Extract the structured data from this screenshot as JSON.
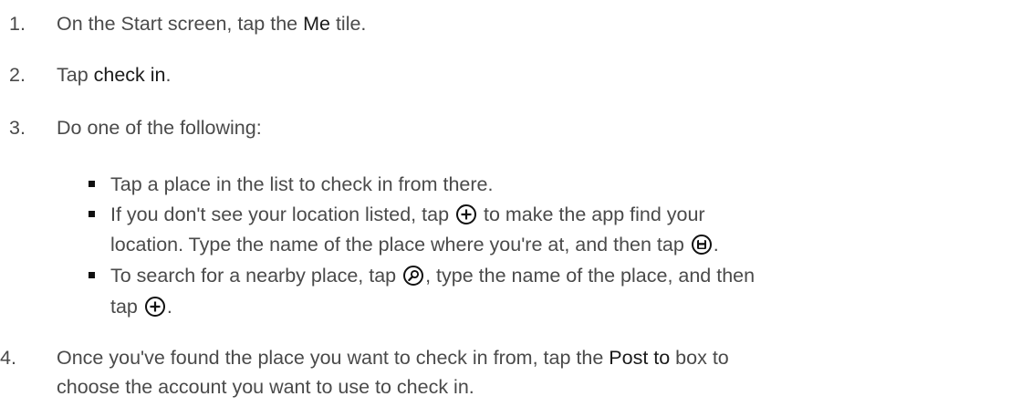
{
  "steps": [
    {
      "number": "1.",
      "pre": "On the Start screen, tap the ",
      "term": "Me",
      "post": " tile."
    },
    {
      "number": "2.",
      "pre": "Tap ",
      "term": "check in",
      "post": "."
    },
    {
      "number": "3.",
      "text": "Do one of the following:"
    },
    {
      "number": "4.",
      "line1_pre": "Once you've found the place you want to check in from, tap the ",
      "line1_term": "Post to",
      "line1_post": " box to",
      "line2": "choose the account you want to use to check in."
    }
  ],
  "bullets": [
    {
      "text": "Tap a place in the list to check in from there."
    },
    {
      "line1_pre": "If you don't see your location listed, tap ",
      "line1_icon": "plus-circle-icon",
      "line1_post": " to make the app find your",
      "line2_pre": "location. Type the name of the place where you're at, and then tap ",
      "line2_icon": "save-circle-icon",
      "line2_post": "."
    },
    {
      "line1_pre": "To search for a nearby place, tap ",
      "line1_icon": "search-circle-icon",
      "line1_post": ", type the name of the place, and then",
      "line2_pre": "tap ",
      "line2_icon": "plus-circle-icon",
      "line2_post": "."
    }
  ]
}
